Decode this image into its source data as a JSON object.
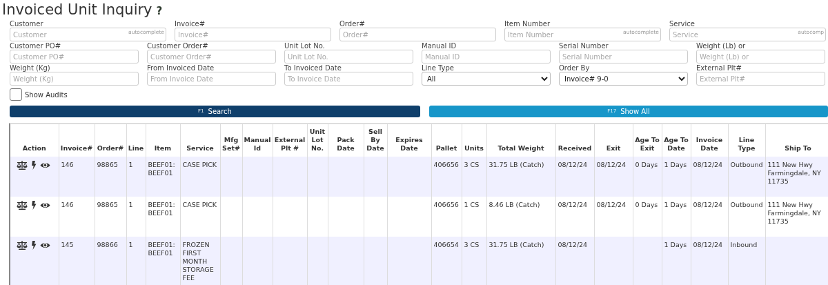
{
  "title": "Invoiced Unit Inquiry",
  "help": "?",
  "filter_rows": [
    {
      "fields": [
        {
          "kind": "input",
          "label": "Customer",
          "placeholder": "Customer",
          "hint": "autocomplete"
        },
        {
          "kind": "input",
          "label": "Invoice#",
          "placeholder": "Invoice#"
        },
        {
          "kind": "input",
          "label": "Order#",
          "placeholder": "Order#"
        },
        {
          "kind": "input",
          "label": "Item Number",
          "placeholder": "Item Number",
          "hint": "autocomplete"
        },
        {
          "kind": "input",
          "label": "Service",
          "placeholder": "Service",
          "hint": "autocomp"
        }
      ]
    },
    {
      "fields": [
        {
          "kind": "input",
          "label": "Customer PO#",
          "placeholder": "Customer PO#"
        },
        {
          "kind": "input",
          "label": "Customer Order#",
          "placeholder": "Customer Order#"
        },
        {
          "kind": "input",
          "label": "Unit Lot No.",
          "placeholder": "Unit Lot No."
        },
        {
          "kind": "input",
          "label": "Manual ID",
          "placeholder": "Manual ID"
        },
        {
          "kind": "input",
          "label": "Serial Number",
          "placeholder": "Serial Number"
        },
        {
          "kind": "input",
          "label": "Weight (Lb) or",
          "placeholder": "Weight (Lb) or"
        }
      ]
    },
    {
      "fields": [
        {
          "kind": "input",
          "label": "Weight (Kg)",
          "placeholder": "Weight (Kg)"
        },
        {
          "kind": "input",
          "label": "From Invoiced Date",
          "placeholder": "From Invoice Date"
        },
        {
          "kind": "input",
          "label": "To Invoiced Date",
          "placeholder": "To Invoice Date"
        },
        {
          "kind": "select",
          "label": "Line Type",
          "value": "All"
        },
        {
          "kind": "select",
          "label": "Order By",
          "value": "Invoice# 9-0"
        },
        {
          "kind": "input",
          "label": "External Plt#",
          "placeholder": "External Plt#"
        }
      ]
    }
  ],
  "show_audits": {
    "label": "Show Audits",
    "checked": false
  },
  "buttons": [
    {
      "kind": "primary",
      "key": "F1",
      "label": "Search"
    },
    {
      "kind": "secondary",
      "key": "F17",
      "label": "Show All"
    }
  ],
  "table": {
    "columns": [
      "Action",
      "Invoice#",
      "Order#",
      "Line",
      "Item",
      "Service",
      "Mfg Set#",
      "Manual Id",
      "External Plt #",
      "Unit Lot No.",
      "Pack Date",
      "Sell By Date",
      "Expires Date",
      "Pallet",
      "Units",
      "Total Weight",
      "Received",
      "Exit",
      "Age To Exit",
      "Age To Date",
      "Invoice Date",
      "Line Type",
      "Ship To"
    ],
    "rows": [
      {
        "cells": [
          "",
          "146",
          "98865",
          "1",
          "BEEF01: BEEF01",
          "CASE PICK",
          "",
          "",
          "",
          "",
          "",
          "",
          "",
          "406656",
          "3 CS",
          "31.75 LB (Catch)",
          "08/12/24",
          "08/12/24",
          "0 Days",
          "1 Days",
          "08/12/24",
          "Outbound",
          "111 New Hwy Farmingdale, NY 11735"
        ]
      },
      {
        "cells": [
          "",
          "146",
          "98865",
          "1",
          "BEEF01: BEEF01",
          "CASE PICK",
          "",
          "",
          "",
          "",
          "",
          "",
          "",
          "406656",
          "1 CS",
          "8.46 LB (Catch)",
          "08/12/24",
          "08/12/24",
          "0 Days",
          "1 Days",
          "08/12/24",
          "Outbound",
          "111 New Hwy Farmingdale, NY 11735"
        ]
      },
      {
        "cells": [
          "",
          "145",
          "98866",
          "1",
          "BEEF01: BEEF01",
          "FROZEN FIRST MONTH STORAGE FEE",
          "",
          "",
          "",
          "",
          "",
          "",
          "",
          "406654",
          "3 CS",
          "31.75 LB (Catch)",
          "08/12/24",
          "",
          "",
          "1 Days",
          "08/12/24",
          "Inbound",
          ""
        ]
      }
    ]
  }
}
